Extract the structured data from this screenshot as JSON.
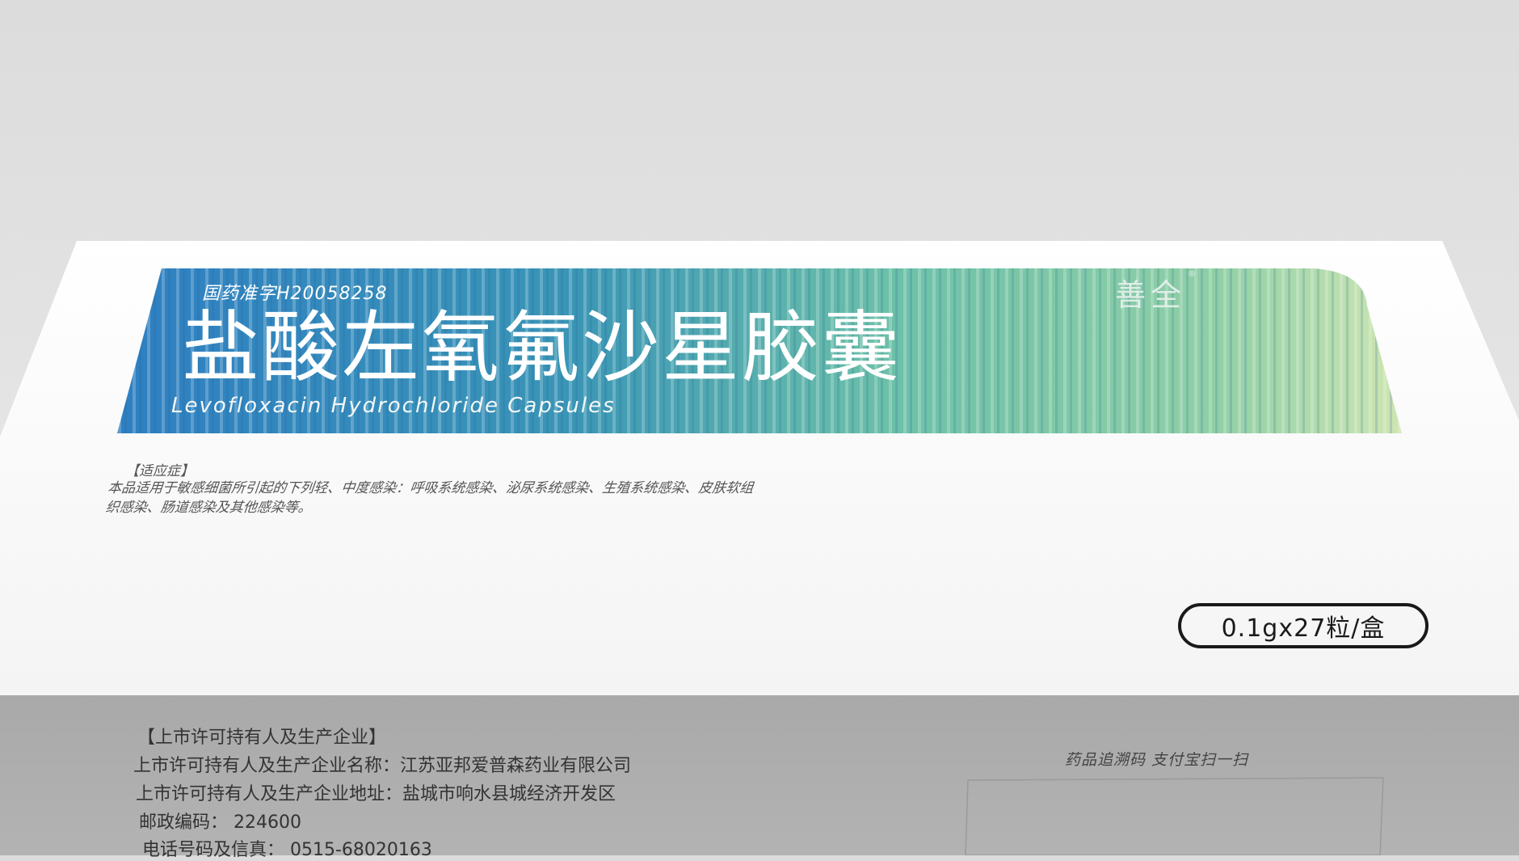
{
  "package": {
    "approval_number": "国药准字H20058258",
    "name_cn": "盐酸左氧氟沙星胶囊",
    "name_en": "Levofloxacin Hydrochloride  Capsules",
    "brand": "善全",
    "brand_mark": "®"
  },
  "indication": {
    "heading": "【适应症】",
    "text": "本品适用于敏感细菌所引起的下列轻、中度感染：呼吸系统感染、泌尿系统感染、生殖系统感染、皮肤软组织感染、肠道感染及其他感染等。"
  },
  "spec": "0.1gx27粒/盒",
  "manufacturer": {
    "heading": "【上市许可持有人及生产企业】",
    "name_line": "上市许可持有人及生产企业名称：江苏亚邦爱普森药业有限公司",
    "address_line": "上市许可持有人及生产企业地址：盐城市响水县城经济开发区",
    "postcode_line": "邮政编码：  224600",
    "phone_line": "电话号码及信真：  0515-68020163"
  },
  "trace": {
    "label": "药品追溯码   支付宝扫一扫"
  },
  "colors": {
    "banner_blue": "#2e7fc2",
    "banner_teal": "#6cc0a8",
    "banner_light": "#cfe6b2",
    "spec_border": "#1a1a1a"
  }
}
